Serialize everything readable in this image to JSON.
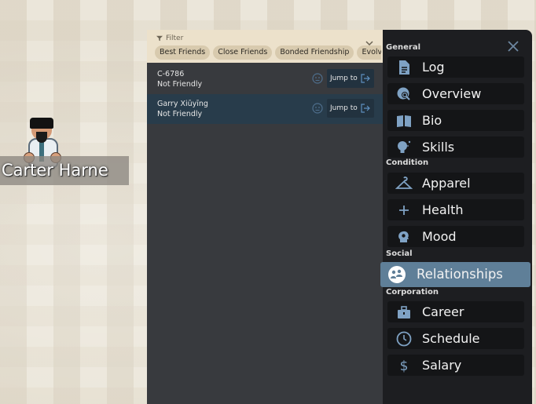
{
  "character": {
    "name": "Carter Harne"
  },
  "relationships": {
    "filter_label": "Filter",
    "chips": [
      "Best Friends",
      "Close Friends",
      "Bonded Friendship",
      "Evolvin"
    ],
    "rows": [
      {
        "name": "C-6786",
        "status": "Not Friendly",
        "jump_label": "Jump to"
      },
      {
        "name": "Garry Xiūyīng",
        "status": "Not Friendly",
        "jump_label": "Jump to"
      }
    ]
  },
  "sidebar": {
    "sections": {
      "general": "General",
      "condition": "Condition",
      "social": "Social",
      "corporation": "Corporation"
    },
    "items": [
      {
        "label": "Log",
        "icon": "log-icon"
      },
      {
        "label": "Overview",
        "icon": "overview-icon"
      },
      {
        "label": "Bio",
        "icon": "bio-icon"
      },
      {
        "label": "Skills",
        "icon": "skills-icon"
      },
      {
        "label": "Apparel",
        "icon": "apparel-icon"
      },
      {
        "label": "Health",
        "icon": "health-icon"
      },
      {
        "label": "Mood",
        "icon": "mood-icon"
      },
      {
        "label": "Relationships",
        "icon": "relationships-icon",
        "active": true
      },
      {
        "label": "Career",
        "icon": "career-icon"
      },
      {
        "label": "Schedule",
        "icon": "schedule-icon"
      },
      {
        "label": "Salary",
        "icon": "salary-icon"
      }
    ]
  },
  "colors": {
    "accent": "#5f7f98",
    "icon": "#7fa2c4",
    "panel_bg": "#383a3e",
    "sidebar_bg": "#1d1e21",
    "header_bg": "#ece1cb"
  }
}
